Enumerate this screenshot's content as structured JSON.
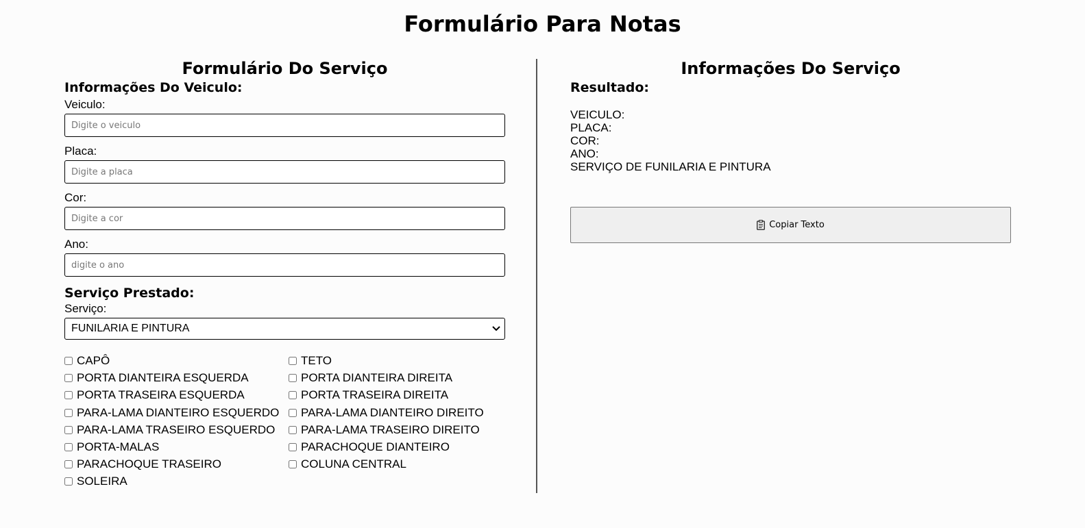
{
  "page": {
    "title": "Formulário Para Notas"
  },
  "form": {
    "title": "Formulário Do Serviço",
    "vehicle_section": "Informações Do Veiculo:",
    "fields": [
      {
        "label": "Veiculo:",
        "placeholder": "Digite o veiculo",
        "value": ""
      },
      {
        "label": "Placa:",
        "placeholder": "Digite a placa",
        "value": ""
      },
      {
        "label": "Cor:",
        "placeholder": "Digite a cor",
        "value": ""
      },
      {
        "label": "Ano:",
        "placeholder": "digite o ano",
        "value": ""
      }
    ],
    "service_section": "Serviço Prestado:",
    "service_label": "Serviço:",
    "service_selected": "FUNILARIA E PINTURA",
    "checkboxes": [
      {
        "label": "CAPÔ",
        "checked": false
      },
      {
        "label": "TETO",
        "checked": false
      },
      {
        "label": "PORTA DIANTEIRA ESQUERDA",
        "checked": false
      },
      {
        "label": "PORTA DIANTEIRA DIREITA",
        "checked": false
      },
      {
        "label": "PORTA TRASEIRA ESQUERDA",
        "checked": false
      },
      {
        "label": "PORTA TRASEIRA DIREITA",
        "checked": false
      },
      {
        "label": "PARA-LAMA DIANTEIRO ESQUERDO",
        "checked": false
      },
      {
        "label": "PARA-LAMA DIANTEIRO DIREITO",
        "checked": false
      },
      {
        "label": "PARA-LAMA TRASEIRO ESQUERDO",
        "checked": false
      },
      {
        "label": "PARA-LAMA TRASEIRO DIREITO",
        "checked": false
      },
      {
        "label": "PORTA-MALAS",
        "checked": false
      },
      {
        "label": "PARACHOQUE DIANTEIRO",
        "checked": false
      },
      {
        "label": "PARACHOQUE TRASEIRO",
        "checked": false
      },
      {
        "label": "COLUNA CENTRAL",
        "checked": false
      },
      {
        "label": "SOLEIRA",
        "checked": false
      }
    ]
  },
  "info": {
    "title": "Informações Do Serviço",
    "result_label": "Resultado:",
    "result_lines": [
      "VEICULO:",
      "PLACA:",
      "COR:",
      "ANO:",
      "SERVIÇO DE FUNILARIA E PINTURA"
    ],
    "copy_button_label": "Copiar Texto",
    "copy_button_icon": "clipboard-icon"
  }
}
